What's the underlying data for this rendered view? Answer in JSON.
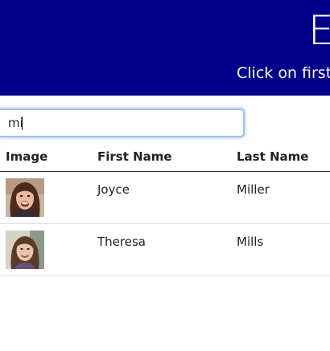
{
  "header": {
    "title": "E",
    "subtitle": "Click on first o"
  },
  "search": {
    "value": "mi"
  },
  "table": {
    "columns": [
      "Image",
      "First Name",
      "Last Name"
    ],
    "rows": [
      {
        "image": "avatar-woman-smiling",
        "first_name": "Joyce",
        "last_name": "Miller"
      },
      {
        "image": "avatar-woman-portrait",
        "first_name": "Theresa",
        "last_name": "Mills"
      }
    ]
  },
  "colors": {
    "header_bg": "#00008b",
    "focus_ring": "#9ec3f5"
  }
}
